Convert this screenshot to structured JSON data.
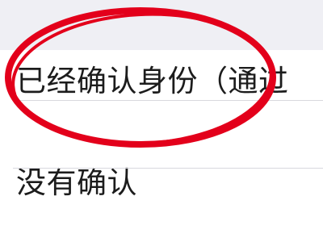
{
  "settings_list": {
    "items": [
      {
        "label": "已经确认身份（通过"
      },
      {
        "label": "没有确认"
      }
    ]
  },
  "annotation": {
    "ring_color": "#e3001b"
  }
}
